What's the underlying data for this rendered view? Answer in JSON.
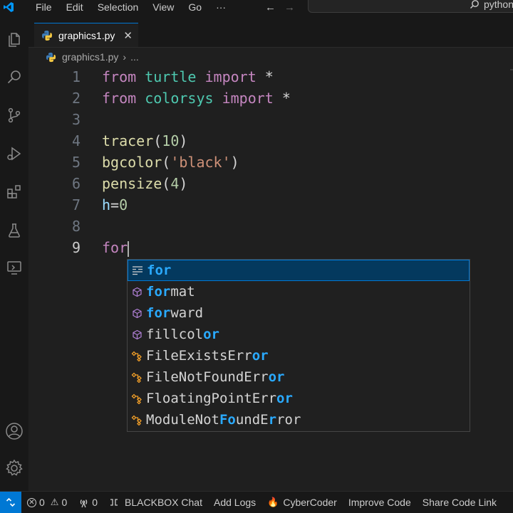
{
  "menu": [
    "File",
    "Edit",
    "Selection",
    "View",
    "Go",
    "···"
  ],
  "search": {
    "label": "python"
  },
  "tab": {
    "name": "graphics1.py",
    "close": "✕"
  },
  "breadcrumb": {
    "file": "graphics1.py",
    "more": "..."
  },
  "code": [
    {
      "num": "1",
      "tokens": [
        [
          "kw",
          "from"
        ],
        [
          "pl",
          " "
        ],
        [
          "mod",
          "turtle"
        ],
        [
          "pl",
          " "
        ],
        [
          "kw",
          "import"
        ],
        [
          "pl",
          " *"
        ]
      ]
    },
    {
      "num": "2",
      "tokens": [
        [
          "kw",
          "from"
        ],
        [
          "pl",
          " "
        ],
        [
          "mod",
          "colorsys"
        ],
        [
          "pl",
          " "
        ],
        [
          "kw",
          "import"
        ],
        [
          "pl",
          " *"
        ]
      ]
    },
    {
      "num": "3",
      "tokens": []
    },
    {
      "num": "4",
      "tokens": [
        [
          "fn",
          "tracer"
        ],
        [
          "pl",
          "("
        ],
        [
          "num",
          "10"
        ],
        [
          "pl",
          ")"
        ]
      ]
    },
    {
      "num": "5",
      "tokens": [
        [
          "fn",
          "bgcolor"
        ],
        [
          "pl",
          "("
        ],
        [
          "str",
          "'black'"
        ],
        [
          "pl",
          ")"
        ]
      ]
    },
    {
      "num": "6",
      "tokens": [
        [
          "fn",
          "pensize"
        ],
        [
          "pl",
          "("
        ],
        [
          "num",
          "4"
        ],
        [
          "pl",
          ")"
        ]
      ]
    },
    {
      "num": "7",
      "tokens": [
        [
          "var",
          "h"
        ],
        [
          "pl",
          "="
        ],
        [
          "num",
          "0"
        ]
      ]
    },
    {
      "num": "8",
      "tokens": []
    },
    {
      "num": "9",
      "tokens": [
        [
          "kw",
          "for"
        ]
      ]
    }
  ],
  "suggestions": [
    {
      "icon": "keyword-icon",
      "parts": [
        [
          "hl",
          "for"
        ]
      ]
    },
    {
      "icon": "method-icon",
      "parts": [
        [
          "hl",
          "for"
        ],
        [
          "txt",
          "mat"
        ]
      ]
    },
    {
      "icon": "method-icon",
      "parts": [
        [
          "hl",
          "for"
        ],
        [
          "txt",
          "ward"
        ]
      ]
    },
    {
      "icon": "method-icon",
      "parts": [
        [
          "txt",
          "fillcol"
        ],
        [
          "hl",
          "or"
        ]
      ]
    },
    {
      "icon": "class-icon",
      "parts": [
        [
          "txt",
          "FileExistsErr"
        ],
        [
          "hl",
          "or"
        ]
      ]
    },
    {
      "icon": "class-icon",
      "parts": [
        [
          "txt",
          "FileNotFoundErr"
        ],
        [
          "hl",
          "or"
        ]
      ]
    },
    {
      "icon": "class-icon",
      "parts": [
        [
          "txt",
          "FloatingPointErr"
        ],
        [
          "hl",
          "or"
        ]
      ]
    },
    {
      "icon": "class-icon",
      "parts": [
        [
          "txt",
          "ModuleNot"
        ],
        [
          "hl",
          "Fo"
        ],
        [
          "txt",
          "undE"
        ],
        [
          "hl",
          "r"
        ],
        [
          "txt",
          "ror"
        ]
      ]
    }
  ],
  "status": {
    "errors": "0",
    "warnings": "0",
    "ports": "0",
    "items": [
      "BLACKBOX Chat",
      "Add Logs",
      "CyberCoder",
      "Improve Code",
      "Share Code Link"
    ]
  },
  "colors": {
    "accent": "#0078d4",
    "highlight": "#2aaaff",
    "keyword": "#c586c0",
    "module": "#4ec9b0"
  }
}
